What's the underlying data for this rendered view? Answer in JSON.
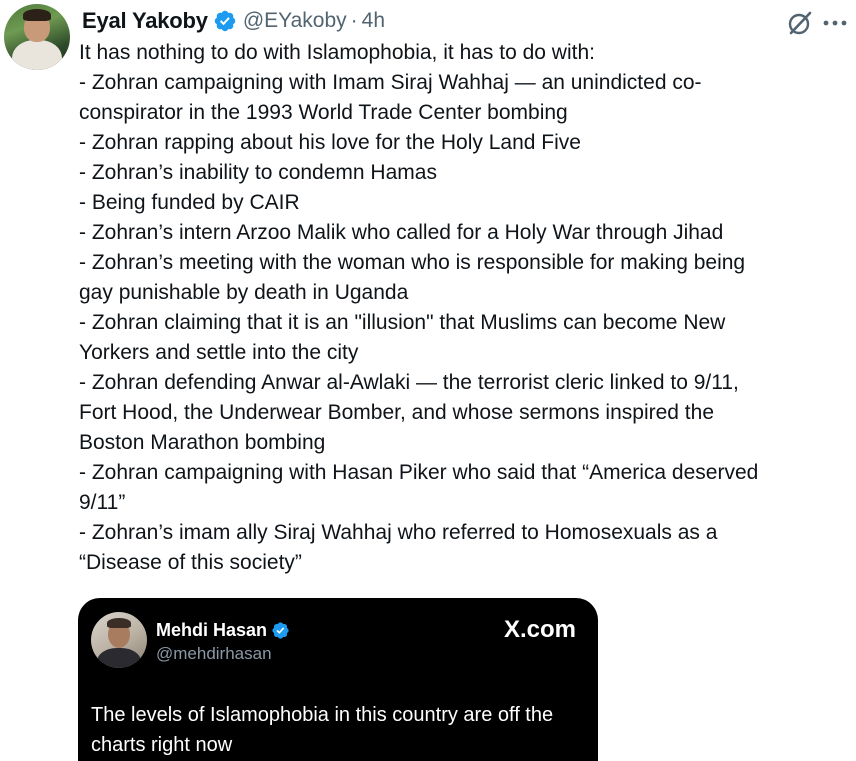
{
  "author": {
    "display_name": "Eyal Yakoby",
    "handle": "@EYakoby",
    "separator": "·",
    "time": "4h",
    "verified": true
  },
  "icons": {
    "verified": "verified-badge-icon",
    "grok": "grok-icon",
    "more": "more-options-icon"
  },
  "colors": {
    "verified_blue": "#1d9bf0",
    "secondary_text": "#536471",
    "quote_background": "#000000"
  },
  "tweet": {
    "lines": [
      "It has nothing to do with Islamophobia, it has to do with:",
      "- Zohran campaigning with Imam Siraj Wahhaj — an unindicted co-",
      "conspirator in the 1993 World Trade Center bombing",
      "- Zohran rapping about his love for the Holy Land Five",
      "- Zohran’s inability to condemn Hamas",
      "- Being funded by CAIR",
      "- Zohran’s intern Arzoo Malik who called for a Holy War through Jihad",
      "- Zohran’s meeting with the woman who is responsible for making being",
      "gay punishable by death in Uganda",
      "- Zohran claiming that it is an \"illusion\" that Muslims can become New",
      "Yorkers and settle into the city",
      "- Zohran defending Anwar al-Awlaki — the terrorist cleric linked to 9/11,",
      "Fort Hood, the Underwear Bomber, and whose sermons inspired the",
      "Boston Marathon bombing",
      "- Zohran campaigning with Hasan Piker who said that “America deserved",
      "9/11”",
      "- Zohran’s imam ally Siraj Wahhaj who referred to Homosexuals as a",
      "“Disease of this society”"
    ]
  },
  "quote": {
    "display_name": "Mehdi Hasan",
    "handle": "@mehdirhasan",
    "verified": true,
    "brand": "X.com",
    "text": "The levels of Islamophobia in this country are off the charts right now"
  }
}
